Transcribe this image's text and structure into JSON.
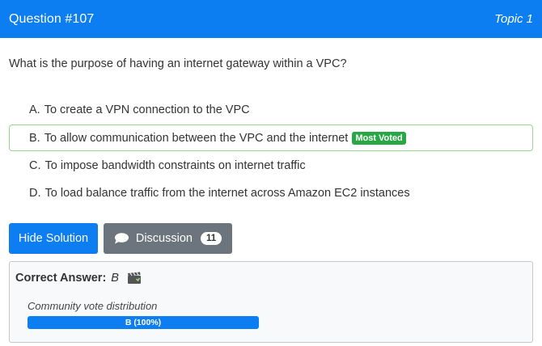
{
  "header": {
    "question_number": "Question #107",
    "topic": "Topic 1"
  },
  "question": {
    "text": "What is the purpose of having an internet gateway within a VPC?"
  },
  "choices": [
    {
      "letter": "A.",
      "text": "To create a VPN connection to the VPC",
      "badge": null
    },
    {
      "letter": "B.",
      "text": "To allow communication between the VPC and the internet",
      "badge": "Most Voted"
    },
    {
      "letter": "C.",
      "text": "To impose bandwidth constraints on internet traffic",
      "badge": null
    },
    {
      "letter": "D.",
      "text": "To load balance traffic from the internet across Amazon EC2 instances",
      "badge": null
    }
  ],
  "buttons": {
    "hide_solution": "Hide Solution",
    "discussion": "Discussion",
    "discussion_count": "11"
  },
  "answer": {
    "label": "Correct Answer:",
    "value": "B",
    "vote_label": "Community vote distribution",
    "vote_bar_text": "B (100%)",
    "vote_fraction": 1.0
  },
  "colors": {
    "primary": "#0d7ef2",
    "secondary": "#6c757d",
    "success": "#28a745",
    "voted_border": "#97d88f"
  },
  "icons": {
    "discussion": "speech-bubble-icon",
    "answer": "clapperboard-icon"
  }
}
